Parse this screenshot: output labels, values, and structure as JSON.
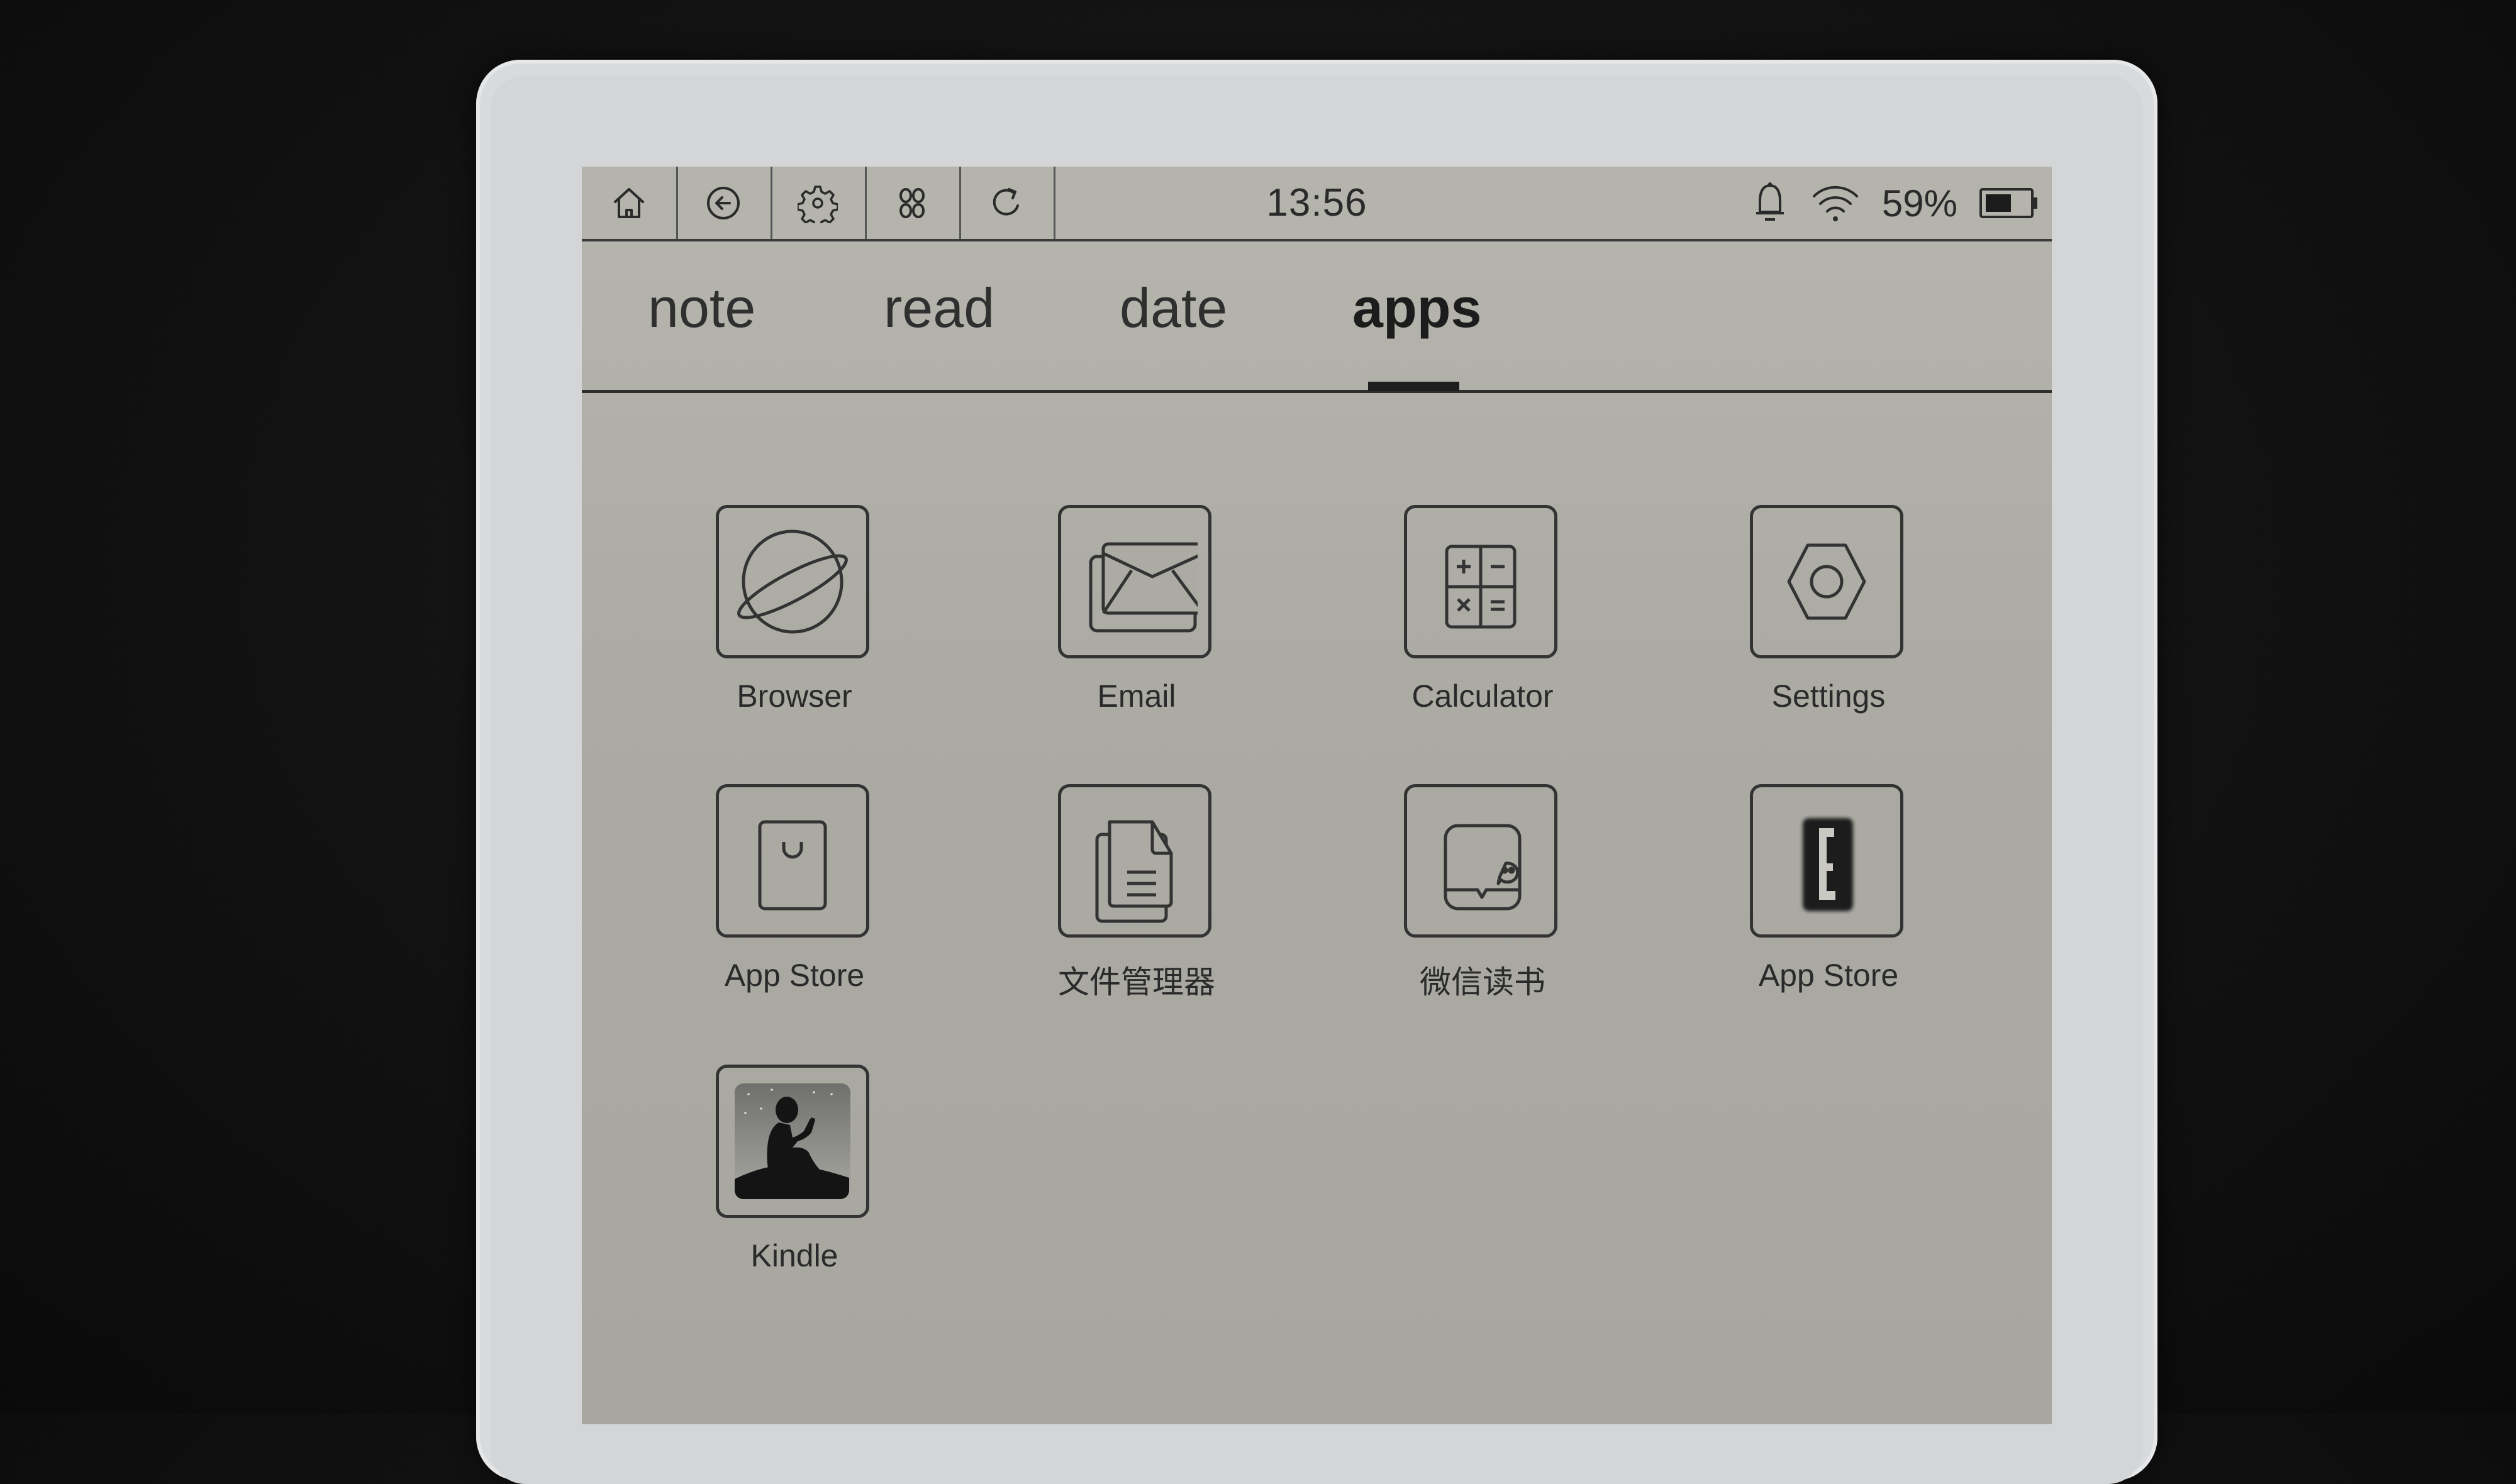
{
  "toolbar": {
    "buttons": [
      {
        "name": "home",
        "icon": "home-icon"
      },
      {
        "name": "back",
        "icon": "back-arrow-circle-icon"
      },
      {
        "name": "settings",
        "icon": "gear-icon"
      },
      {
        "name": "apps",
        "icon": "command-clover-icon"
      },
      {
        "name": "refresh",
        "icon": "refresh-icon"
      }
    ],
    "time": "13:56",
    "status": {
      "notification_icon": "bell-icon",
      "wifi_icon": "wifi-icon",
      "battery_percent_text": "59%",
      "battery_level": 0.59,
      "battery_icon": "battery-icon"
    }
  },
  "tabs": [
    {
      "label": "note",
      "active": false
    },
    {
      "label": "read",
      "active": false
    },
    {
      "label": "date",
      "active": false
    },
    {
      "label": "apps",
      "active": true
    }
  ],
  "apps": [
    {
      "label": "Browser",
      "icon": "planet-icon"
    },
    {
      "label": "Email",
      "icon": "envelope-icon"
    },
    {
      "label": "Calculator",
      "icon": "calculator-icon"
    },
    {
      "label": "Settings",
      "icon": "hex-nut-icon"
    },
    {
      "label": "App Store",
      "icon": "shopping-bag-icon"
    },
    {
      "label": "文件管理器",
      "icon": "documents-icon"
    },
    {
      "label": "微信读书",
      "icon": "wechat-reading-icon"
    },
    {
      "label": "App Store",
      "icon": "e-letter-icon"
    },
    {
      "label": "Kindle",
      "icon": "kindle-reader-icon"
    }
  ],
  "colors": {
    "screen": "#abaaa3",
    "ink": "#2a2a2a",
    "bezel": "#d9dadc",
    "background": "#121112"
  }
}
